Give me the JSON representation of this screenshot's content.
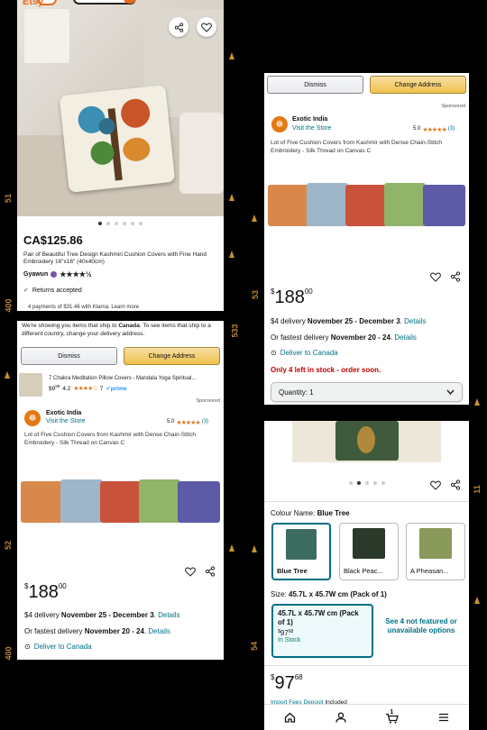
{
  "film": {
    "numbers": [
      "51",
      "400",
      "53",
      "533",
      "52",
      "400",
      "55",
      "11",
      "54"
    ]
  },
  "p1": {
    "header_logo": "Etsy",
    "price": "CA$125.86",
    "title": "Pair of Beautiful Tree Design Kashmiri Cushion Covers with Fine Hand Embroidery 16\"x16\" (40x40cm)",
    "seller": "Gyawun",
    "stars": "★★★★½",
    "returns": "Returns accepted",
    "klarna": "4 payments of $31.46 with Klarna. Learn more",
    "icons": {
      "share": "share-icon",
      "heart": "heart-icon",
      "check": "check-icon"
    }
  },
  "p2": {
    "dismiss": "Dismiss",
    "change_address": "Change Address",
    "sponsored": "Sponsored",
    "brand": "Exotic India",
    "visit": "Visit the Store",
    "rating": "5.0",
    "rating_count": "(3)",
    "desc": "Lot of Five Cushion Covers from Kashmir with Dense Chain-Stitch Embroidery - Silk Thread on Canvas C",
    "price_sym": "$",
    "price_main": "188",
    "price_cents": "00",
    "delivery_prefix": "$4 delivery ",
    "delivery_dates": "November 25 - December 3",
    "details": "Details",
    "fastest_prefix": "Or fastest delivery ",
    "fastest_dates": "November 20 - 24",
    "deliver_to": "Deliver to Canada",
    "stock": "Only 4 left in stock - order soon.",
    "quantity": "Quantity: 1"
  },
  "p3": {
    "notice_pre": "We're showing you items that ship to ",
    "notice_country": "Canada",
    "notice_post": ". To see items that ship to a different country, change your delivery address.",
    "dismiss": "Dismiss",
    "change_address": "Change Address",
    "ad_title": "7 Chakra Meditation Pillow Covers - Mandala Yoga Spiritual...",
    "ad_price": "$9",
    "ad_price_cents": "99",
    "ad_rating": "4.2",
    "ad_count": "7",
    "ad_prime": "✓prime",
    "sponsored": "Sponsored",
    "brand": "Exotic India",
    "visit": "Visit the Store",
    "rating": "5.0",
    "rating_count": "(3)",
    "desc": "Lot of Five Cushion Covers from Kashmir with Dense Chain-Stitch Embroidery - Silk Thread on Canvas C",
    "price_sym": "$",
    "price_main": "188",
    "price_cents": "00",
    "delivery_prefix": "$4 delivery ",
    "delivery_dates": "November 25 - December 3",
    "details": "Details",
    "fastest_prefix": "Or fastest delivery ",
    "fastest_dates": "November 20 - 24",
    "deliver_to": "Deliver to Canada"
  },
  "p4": {
    "colour_label": "Colour Name:",
    "colour_value": "Blue Tree",
    "swatches": [
      "Blue Tree",
      "Black Peac...",
      "A Pheasan..."
    ],
    "size_label": "Size:",
    "size_value": "45.7L x 45.7W cm (Pack of 1)",
    "option_title": "45.7L x 45.7W cm (Pack of 1)",
    "option_price_sym": "$",
    "option_price": "97",
    "option_cents": "68",
    "option_stock": "In Stock",
    "see_more": "See 4 not featured or unavailable options",
    "price_sym": "$",
    "price_main": "97",
    "price_cents": "68",
    "import_fees": "Import Fees Deposit",
    "included": " Included",
    "nav": [
      "home-icon",
      "account-icon",
      "cart-icon",
      "menu-icon"
    ],
    "cart_count": "1"
  },
  "colors": {
    "accent": "#f0c14b",
    "link": "#007185",
    "star": "#de7921",
    "stock_red": "#c40000",
    "green": "#067d62",
    "selected_border": "#007185"
  }
}
